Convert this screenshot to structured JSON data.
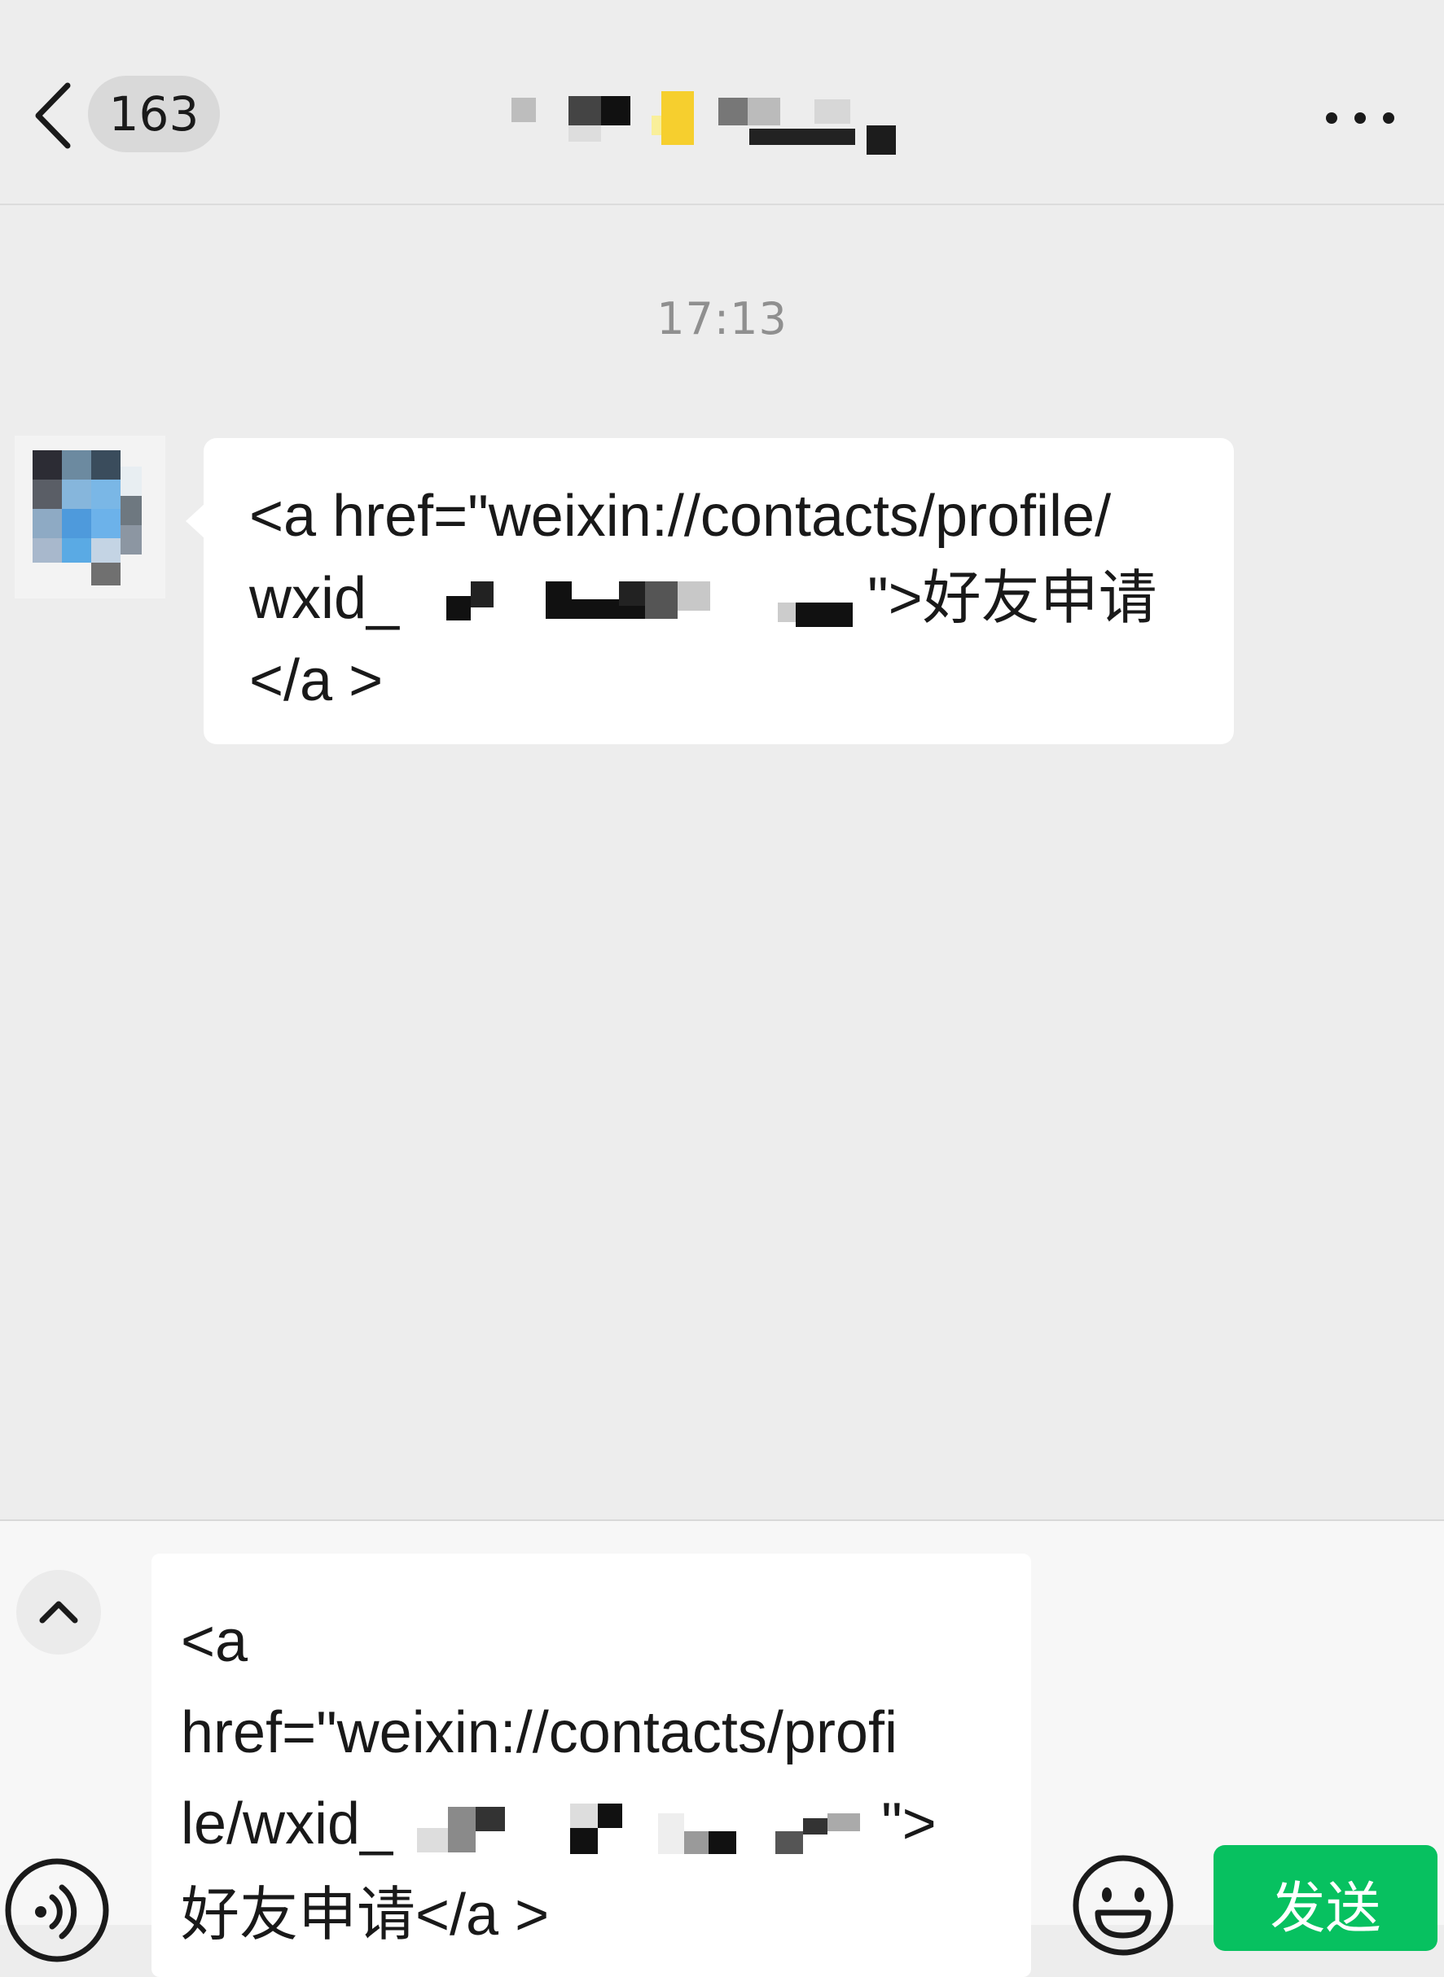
{
  "header": {
    "back_icon": "chevron-left-icon",
    "unread_count": "163",
    "title_redacted": true,
    "more_icon": "ellipsis-icon"
  },
  "chat": {
    "timestamp": "17:13",
    "messages": [
      {
        "sender": "contact",
        "avatar_redacted": true,
        "line1": "<a href=\"weixin://contacts/profile/",
        "line2_prefix": "wxid_",
        "line2_suffix": "\">好友申请",
        "line3": "</a >"
      }
    ]
  },
  "composer": {
    "expand_icon": "chevron-up-icon",
    "voice_icon": "voice-icon",
    "emoji_icon": "emoji-icon",
    "text_line1": "<a",
    "text_line2": "href=\"weixin://contacts/profi",
    "text_line3_prefix": "le/wxid_",
    "text_line3_suffix": "\">",
    "text_line4": "好友申请</a >",
    "send_label": "发送"
  },
  "colors": {
    "background": "#ededed",
    "bubble": "#ffffff",
    "send_button": "#07c160",
    "timestamp": "#8f8f8f"
  }
}
